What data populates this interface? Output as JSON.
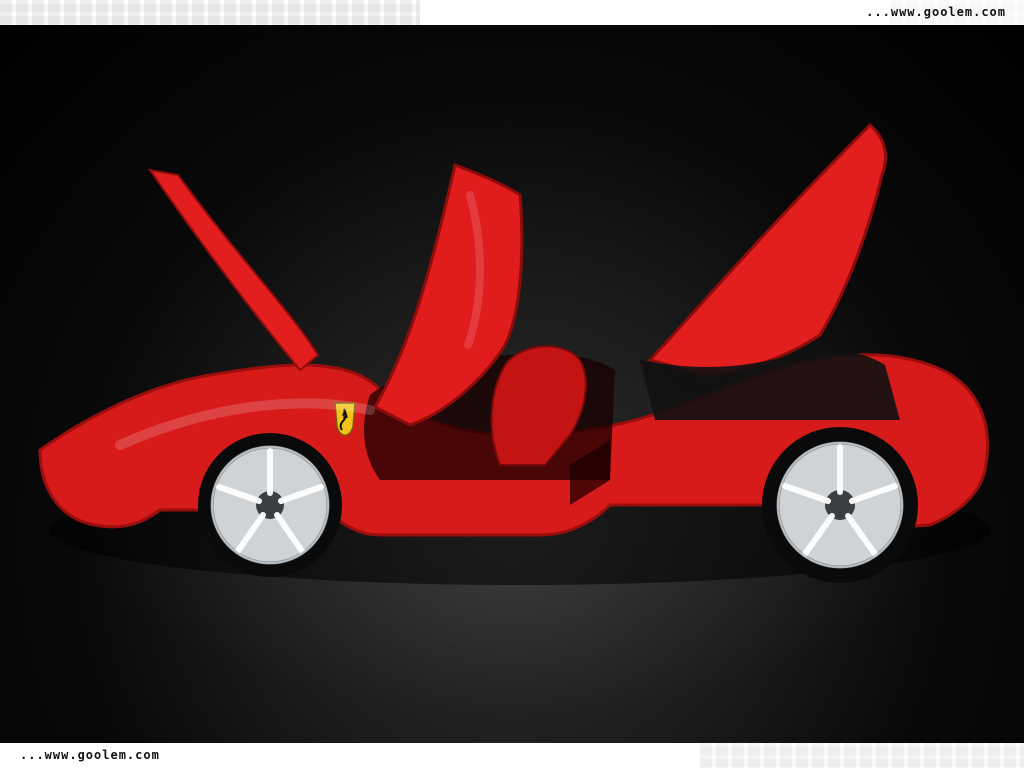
{
  "header": {
    "site": "...www.goolem.com"
  },
  "footer": {
    "site": "...www.goolem.com"
  },
  "colors": {
    "car_red": "#d71a1a",
    "car_red_dark": "#8e0c0c",
    "wheel_silver": "#cfd3d6",
    "badge_yellow": "#f2c21b"
  },
  "icons": {
    "badge": "prancing-horse-badge-icon"
  }
}
